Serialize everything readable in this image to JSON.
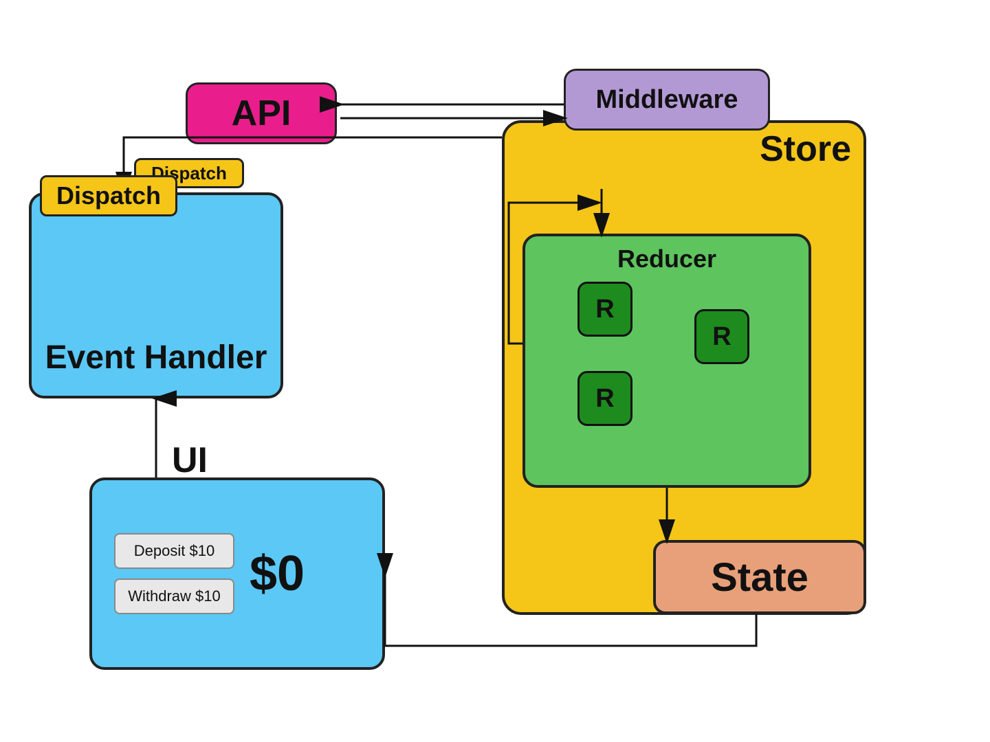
{
  "api": {
    "label": "API"
  },
  "middleware": {
    "label": "Middleware"
  },
  "store": {
    "label": "Store",
    "dispatch_label": "Dispatch"
  },
  "reducer": {
    "label": "Reducer",
    "r_labels": [
      "R",
      "R",
      "R"
    ]
  },
  "state": {
    "label": "State"
  },
  "event_handler": {
    "dispatch_label": "Dispatch",
    "main_label": "Event Handler"
  },
  "ui": {
    "section_label": "UI",
    "buttons": [
      "Deposit $10",
      "Withdraw $10"
    ],
    "amount": "$0"
  }
}
